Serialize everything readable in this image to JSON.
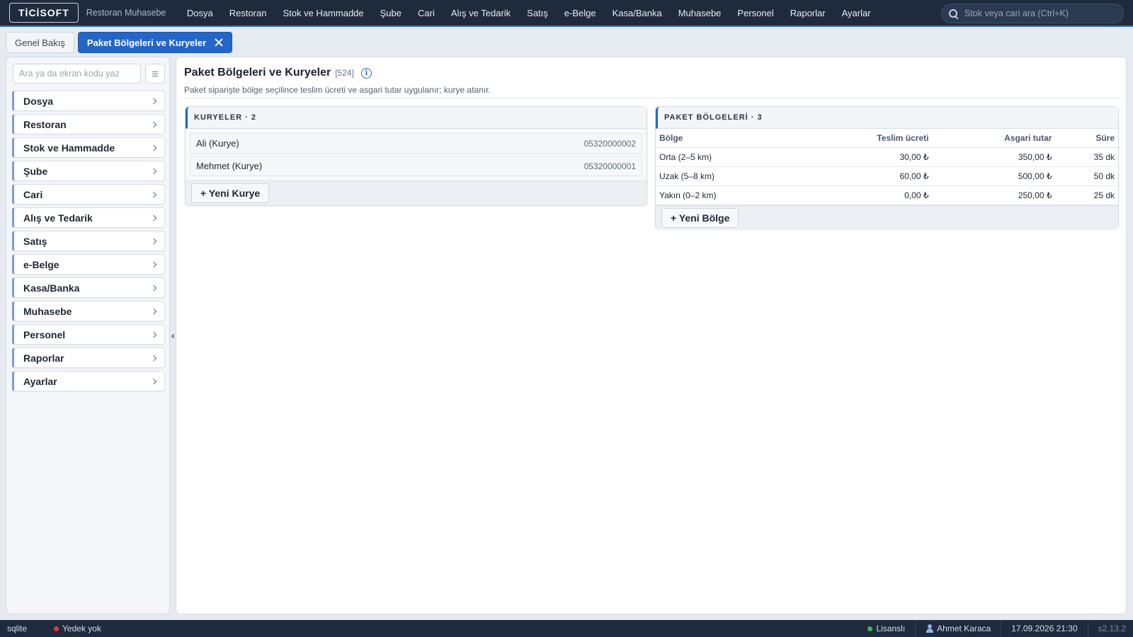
{
  "app": {
    "logo": "TİCİSOFT",
    "subtitle": "Restoran Muhasebe"
  },
  "topmenu": [
    "Dosya",
    "Restoran",
    "Stok ve Hammadde",
    "Şube",
    "Cari",
    "Alış ve Tedarik",
    "Satış",
    "e-Belge",
    "Kasa/Banka",
    "Muhasebe",
    "Personel",
    "Raporlar",
    "Ayarlar"
  ],
  "global_search": {
    "placeholder": "Stok veya cari ara (Ctrl+K)"
  },
  "tabs": [
    {
      "label": "Genel Bakış",
      "active": false
    },
    {
      "label": "Paket Bölgeleri ve Kuryeler",
      "active": true
    }
  ],
  "sidebar": {
    "search_placeholder": "Ara ya da ekran kodu yaz",
    "items": [
      "Dosya",
      "Restoran",
      "Stok ve Hammadde",
      "Şube",
      "Cari",
      "Alış ve Tedarik",
      "Satış",
      "e-Belge",
      "Kasa/Banka",
      "Muhasebe",
      "Personel",
      "Raporlar",
      "Ayarlar"
    ]
  },
  "page": {
    "title": "Paket Bölgeleri ve Kuryeler",
    "code": "[524]",
    "description": "Paket siparişte bölge seçilince teslim ücreti ve asgari tutar uygulanır; kurye atanır."
  },
  "couriers": {
    "header": "KURYELER · 2",
    "items": [
      {
        "name": "Ali (Kurye)",
        "phone": "05320000002"
      },
      {
        "name": "Mehmet (Kurye)",
        "phone": "05320000001"
      }
    ],
    "add_label": "+ Yeni Kurye"
  },
  "zones": {
    "header": "PAKET BÖLGELERİ · 3",
    "columns": [
      "Bölge",
      "Teslim ücreti",
      "Asgari tutar",
      "Süre"
    ],
    "rows": [
      [
        "Orta (2–5 km)",
        "30,00 ₺",
        "350,00 ₺",
        "35 dk"
      ],
      [
        "Uzak (5–8 km)",
        "60,00 ₺",
        "500,00 ₺",
        "50 dk"
      ],
      [
        "Yakın (0–2 km)",
        "0,00 ₺",
        "250,00 ₺",
        "25 dk"
      ]
    ],
    "add_label": "+ Yeni Bölge"
  },
  "statusbar": {
    "db": "sqlite",
    "backup": "Yedek yok",
    "license": "Lisanslı",
    "user": "Ahmet Karaca",
    "datetime": "17.09.2026 21:30",
    "version": "s2.13.2"
  },
  "colors": {
    "accent": "#2466c8",
    "topbar": "#1f2b3d",
    "backup_dot": "#e03a3a",
    "license_dot": "#3bb85a"
  }
}
